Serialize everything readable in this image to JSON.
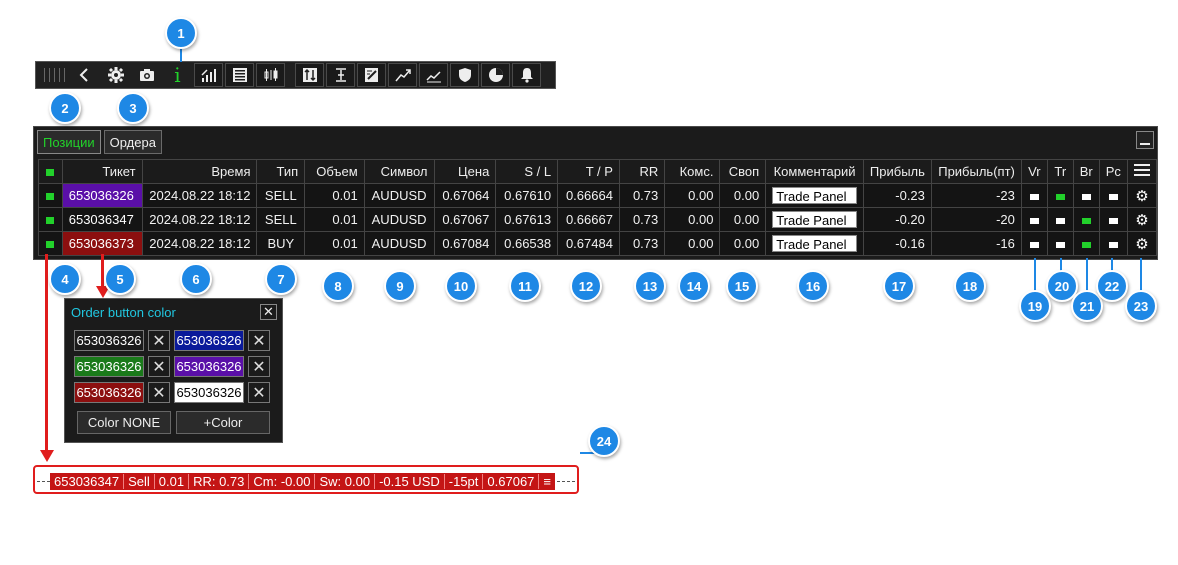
{
  "toolbar": {
    "buttons": [
      "back-icon",
      "gear-icon",
      "camera-icon",
      "info-icon",
      "signal-icon",
      "list-icon",
      "candles-icon",
      "swap-icon",
      "level-icon",
      "edit-icon",
      "trend-icon",
      "trend2-icon",
      "shield-icon",
      "pie-icon",
      "bell-icon"
    ],
    "info_glyph": "i"
  },
  "tabs": {
    "positions": "Позиции",
    "orders": "Ордера"
  },
  "table": {
    "headers": [
      "Тикет",
      "Время",
      "Тип",
      "Объем",
      "Символ",
      "Цена",
      "S / L",
      "T / P",
      "RR",
      "Комс.",
      "Своп",
      "Комментарий",
      "Прибыль",
      "Прибыль(пт)",
      "Vr",
      "Tr",
      "Br",
      "Pc"
    ],
    "rows": [
      {
        "ticket": "653036326",
        "time": "2024.08.22 18:12",
        "type": "SELL",
        "volume": "0.01",
        "symbol": "AUDUSD",
        "price": "0.67064",
        "sl": "0.67610",
        "tp": "0.66664",
        "rr": "0.73",
        "comm": "0.00",
        "swap": "0.00",
        "comment": "Trade Panel",
        "profit": "-0.23",
        "profit_pt": "-23",
        "ticket_color": "#5a0fa8",
        "vr": "white",
        "tr": "green",
        "br": "white",
        "pc": "white"
      },
      {
        "ticket": "653036347",
        "time": "2024.08.22 18:12",
        "type": "SELL",
        "volume": "0.01",
        "symbol": "AUDUSD",
        "price": "0.67067",
        "sl": "0.67613",
        "tp": "0.66667",
        "rr": "0.73",
        "comm": "0.00",
        "swap": "0.00",
        "comment": "Trade Panel",
        "profit": "-0.20",
        "profit_pt": "-20",
        "ticket_color": "#141414",
        "vr": "white",
        "tr": "white",
        "br": "green",
        "pc": "white"
      },
      {
        "ticket": "653036373",
        "time": "2024.08.22 18:12",
        "type": "BUY",
        "volume": "0.01",
        "symbol": "AUDUSD",
        "price": "0.67084",
        "sl": "0.66538",
        "tp": "0.67484",
        "rr": "0.73",
        "comm": "0.00",
        "swap": "0.00",
        "comment": "Trade Panel",
        "profit": "-0.16",
        "profit_pt": "-16",
        "ticket_color": "#8c0f0f",
        "vr": "white",
        "tr": "white",
        "br": "green",
        "pc": "white"
      }
    ]
  },
  "popup": {
    "title": "Order button color",
    "close": "✕",
    "cells": [
      {
        "text": "653036326",
        "color": "#1b1b1b",
        "text_color": "#ffffff"
      },
      {
        "text": "653036326",
        "color": "#0a1a9a",
        "text_color": "#ffffff"
      },
      {
        "text": "653036326",
        "color": "#1a7a1a",
        "text_color": "#ffffff"
      },
      {
        "text": "653036326",
        "color": "#5a0fa8",
        "text_color": "#ffffff"
      },
      {
        "text": "653036326",
        "color": "#8c0f0f",
        "text_color": "#ffffff"
      },
      {
        "text": "653036326",
        "color": "#ffffff",
        "text_color": "#000000"
      }
    ],
    "x": "✕",
    "color_none": "Color NONE",
    "add_color": "+Color"
  },
  "statusbar": [
    "653036347",
    "Sell",
    "0.01",
    "RR: 0.73",
    "Cm: -0.00",
    "Sw: 0.00",
    "-0.15 USD",
    "-15pt",
    "0.67067",
    "≡"
  ],
  "callouts": [
    "1",
    "2",
    "3",
    "4",
    "5",
    "6",
    "7",
    "8",
    "9",
    "10",
    "11",
    "12",
    "13",
    "14",
    "15",
    "16",
    "17",
    "18",
    "19",
    "20",
    "21",
    "22",
    "23",
    "24"
  ],
  "colors": {
    "accent_green": "#22d12b",
    "callout_blue": "#1e88e5",
    "highlight_red": "#e01d1d",
    "popup_title": "#21c7e0"
  }
}
